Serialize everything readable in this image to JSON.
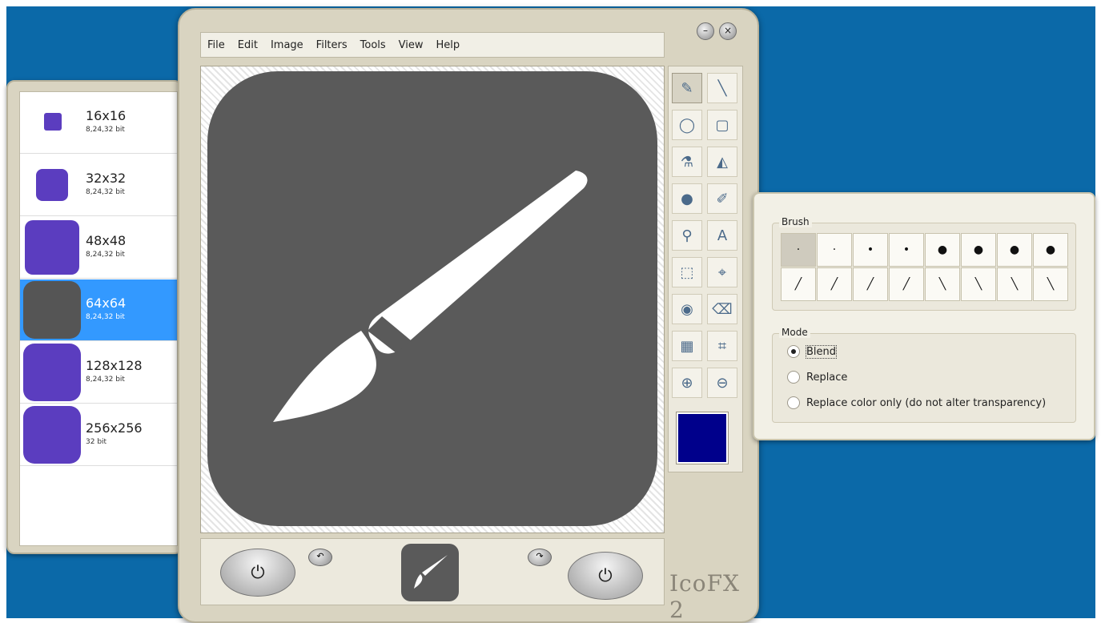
{
  "menu": [
    "File",
    "Edit",
    "Image",
    "Filters",
    "Tools",
    "View",
    "Help"
  ],
  "window_buttons": {
    "minimize": "–",
    "close": "×"
  },
  "sizes": [
    {
      "label": "16x16",
      "bits": "8,24,32 bit",
      "selected": false
    },
    {
      "label": "32x32",
      "bits": "8,24,32 bit",
      "selected": false
    },
    {
      "label": "48x48",
      "bits": "8,24,32 bit",
      "selected": false
    },
    {
      "label": "64x64",
      "bits": "8,24,32 bit",
      "selected": true
    },
    {
      "label": "128x128",
      "bits": "8,24,32 bit",
      "selected": false
    },
    {
      "label": "256x256",
      "bits": "32 bit",
      "selected": false
    }
  ],
  "tools": [
    {
      "name": "pencil-icon",
      "glyph": "✎",
      "active": true
    },
    {
      "name": "line-icon",
      "glyph": "╲",
      "active": false
    },
    {
      "name": "ellipse-icon",
      "glyph": "◯",
      "active": false
    },
    {
      "name": "rounded-rect-icon",
      "glyph": "▢",
      "active": false
    },
    {
      "name": "airbrush-icon",
      "glyph": "⚗",
      "active": false
    },
    {
      "name": "fill-icon",
      "glyph": "◭",
      "active": false
    },
    {
      "name": "blob-icon",
      "glyph": "●",
      "active": false
    },
    {
      "name": "color-picker-icon",
      "glyph": "✐",
      "active": false
    },
    {
      "name": "zoom-tool-icon",
      "glyph": "⚲",
      "active": false
    },
    {
      "name": "text-icon",
      "glyph": "A",
      "active": false
    },
    {
      "name": "select-rect-icon",
      "glyph": "⬚",
      "active": false
    },
    {
      "name": "transform-icon",
      "glyph": "⌖",
      "active": false
    },
    {
      "name": "effects-icon",
      "glyph": "◉",
      "active": false
    },
    {
      "name": "eraser-icon",
      "glyph": "⌫",
      "active": false
    },
    {
      "name": "grid-icon",
      "glyph": "▦",
      "active": false
    },
    {
      "name": "crop-icon",
      "glyph": "⌗",
      "active": false
    },
    {
      "name": "zoom-in-icon",
      "glyph": "⊕",
      "active": false
    },
    {
      "name": "zoom-out-icon",
      "glyph": "⊖",
      "active": false
    }
  ],
  "current_color": "#00008b",
  "bottom": {
    "undo_glyph": "↶",
    "redo_glyph": "↷",
    "left_power": "⏻",
    "right_power": "⏻"
  },
  "brand": "IcoFX 2",
  "brush_panel": {
    "title": "Brush",
    "row1": [
      "·",
      "·",
      "•",
      "•",
      "●",
      "●",
      "●",
      "●"
    ],
    "row2": [
      "╱",
      "╱",
      "╱",
      "╱",
      "╲",
      "╲",
      "╲",
      "╲"
    ]
  },
  "mode_panel": {
    "title": "Mode",
    "options": [
      {
        "label": "Blend",
        "selected": true
      },
      {
        "label": "Replace",
        "selected": false
      },
      {
        "label": "Replace color only (do not alter transparency)",
        "selected": false
      }
    ]
  },
  "colors": {
    "desktop": "#0b69a8",
    "selection": "#3399ff",
    "icon_bg": "#5b3dbf",
    "canvas_icon": "#5a5a5a"
  }
}
